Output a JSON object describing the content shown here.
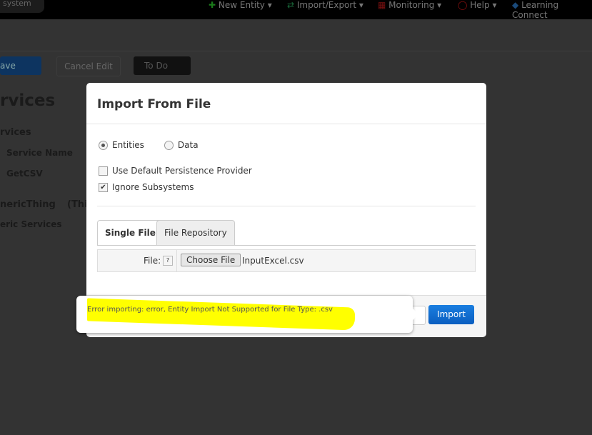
{
  "topbar": {
    "search_text": "system",
    "menus": [
      {
        "label": "New Entity",
        "icon": "plus-icon"
      },
      {
        "label": "Import/Export",
        "icon": "arrows-icon"
      },
      {
        "label": "Monitoring",
        "icon": "monitoring-icon"
      },
      {
        "label": "Help",
        "icon": "lifebuoy-icon"
      },
      {
        "label": "Learning Connect",
        "icon": "graduation-cap-icon"
      }
    ]
  },
  "toolbar": {
    "save": "ave",
    "cancel": "Cancel Edit",
    "todo": "To Do"
  },
  "background": {
    "title": "rvices",
    "section": "rvices",
    "col_header": "Service Name",
    "row": "GetCSV",
    "thing": "nericThing",
    "thing_suffix": "(Thi",
    "generic": "eric Services"
  },
  "modal": {
    "title": "Import From File",
    "radio_entities": "Entities",
    "radio_data": "Data",
    "use_default": "Use Default Persistence Provider",
    "ignore_subsystems": "Ignore Subsystems",
    "tabs": [
      "Single File",
      "File Repository"
    ],
    "file_label": "File:",
    "help": "?",
    "choose_file": "Choose File",
    "filename": "InputExcel.csv",
    "import": "Import"
  },
  "tooltip": {
    "message": "Error importing: error, Entity Import Not Supported for File Type: .csv",
    "highlight_color": "#ffff00"
  }
}
